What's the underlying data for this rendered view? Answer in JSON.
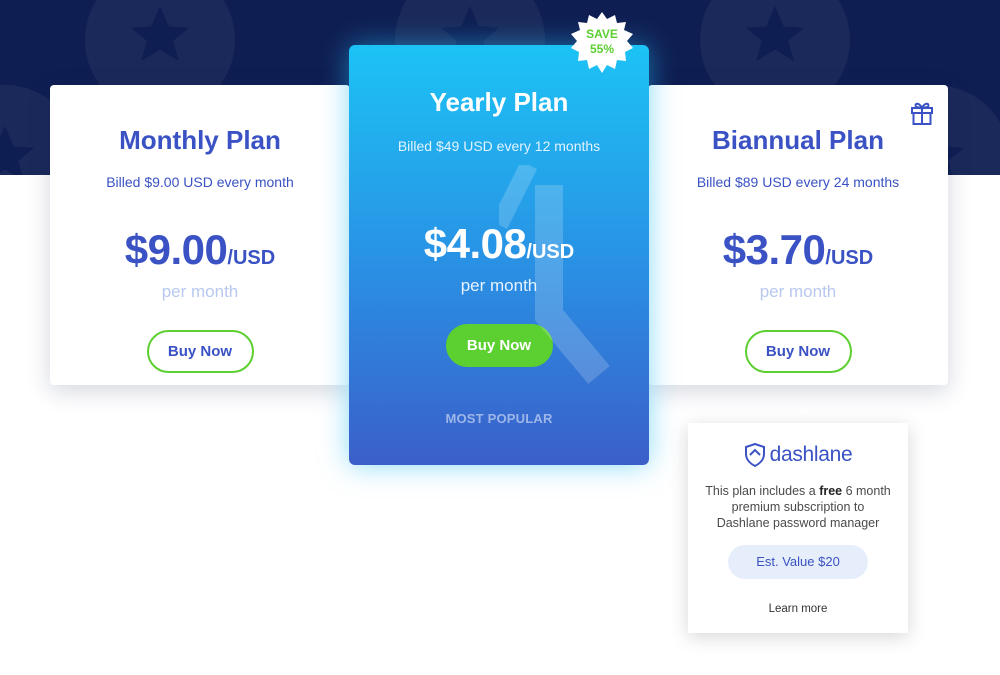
{
  "plans": {
    "monthly": {
      "title": "Monthly Plan",
      "billed": "Billed $9.00 USD every month",
      "price": "$9.00",
      "unit": "/USD",
      "period": "per month",
      "button": "Buy Now"
    },
    "yearly": {
      "title": "Yearly Plan",
      "billed": "Billed $49 USD every 12 months",
      "price": "$4.08",
      "unit": "/USD",
      "period": "per month",
      "button": "Buy Now",
      "tag": "MOST POPULAR",
      "badge_line1": "SAVE",
      "badge_line2": "55%"
    },
    "biannual": {
      "title": "Biannual Plan",
      "billed": "Billed $89 USD every 24 months",
      "price": "$3.70",
      "unit": "/USD",
      "period": "per month",
      "button": "Buy Now"
    }
  },
  "dashlane": {
    "logo": "dashlane",
    "desc_before": "This plan includes a ",
    "desc_bold": "free",
    "desc_after": " 6 month premium subscription to Dashlane password manager",
    "est_value": "Est. Value $20",
    "learn_more": "Learn more"
  },
  "colors": {
    "brand_blue": "#3a52c4",
    "accent_green": "#5ccf31",
    "hero_navy": "#0f1e52",
    "yearly_gradient_top": "#1cc3f5",
    "yearly_gradient_bottom": "#3b5fc8"
  },
  "icons": [
    "star-icon",
    "gift-icon",
    "dashlane-shield-icon",
    "save-badge-icon"
  ]
}
